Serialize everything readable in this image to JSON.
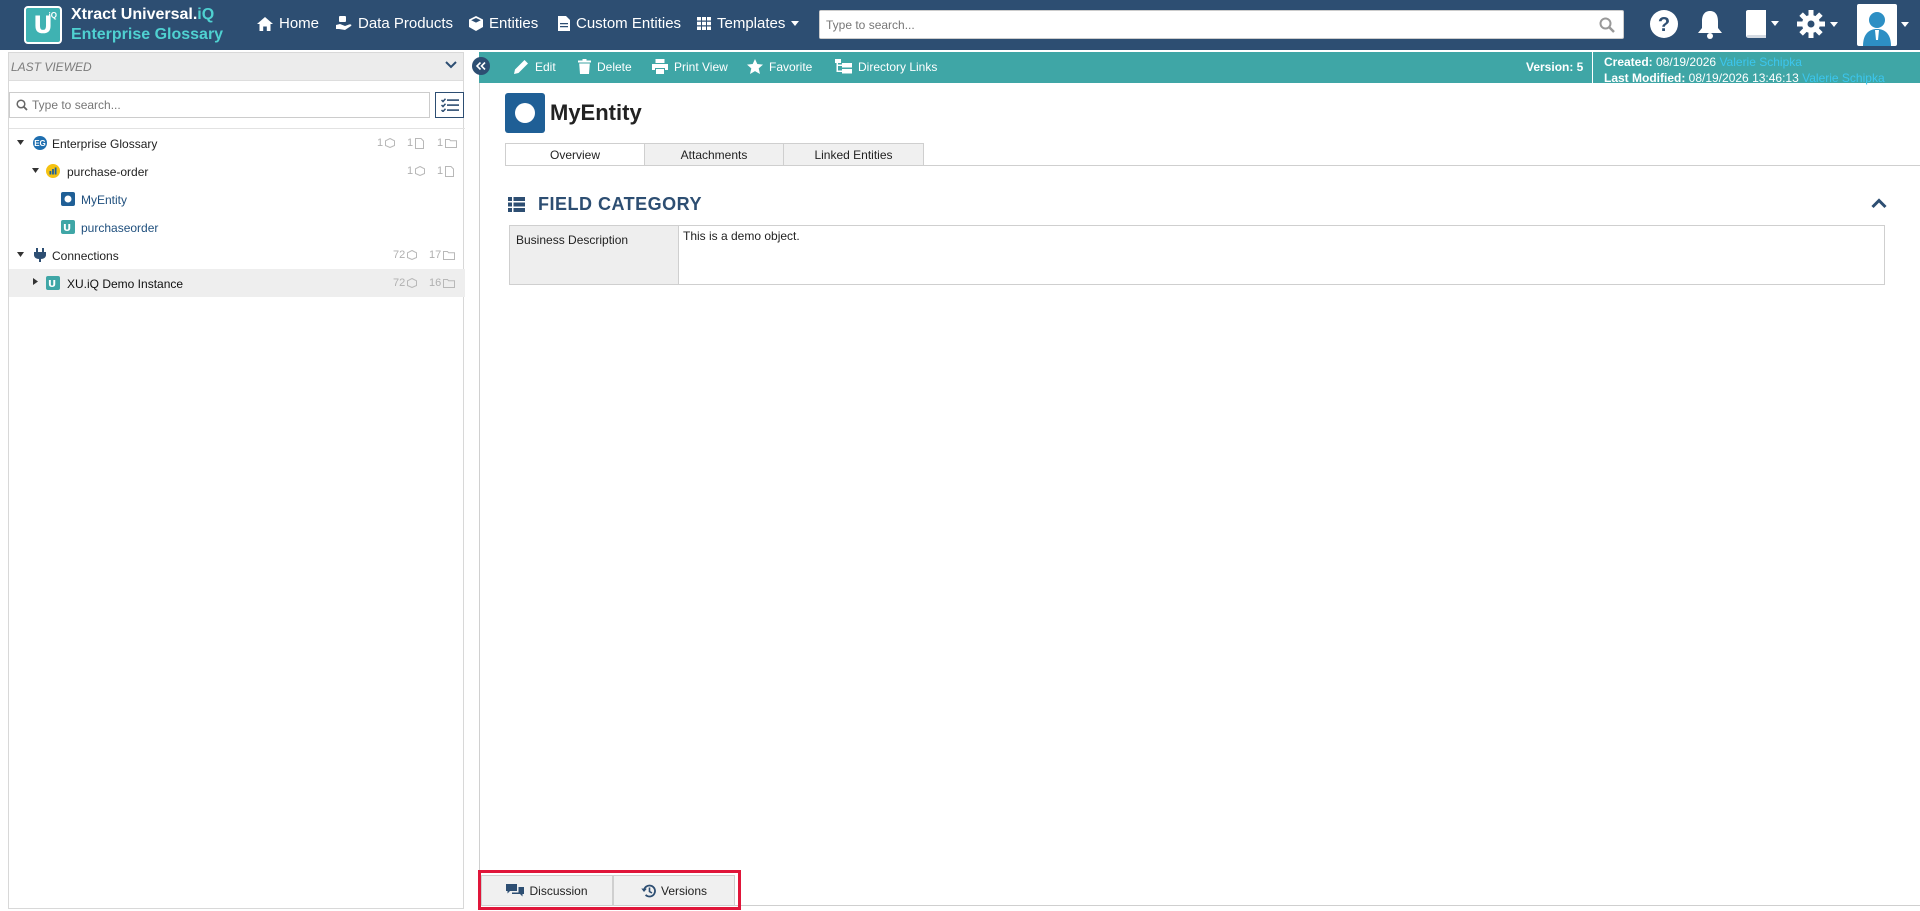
{
  "app": {
    "brand_line1": "Xtract Universal.",
    "brand_iq": "iQ",
    "brand_line2": "Enterprise Glossary",
    "logo_letter": "U",
    "logo_sup": "iQ"
  },
  "nav": {
    "home": "Home",
    "data_products": "Data Products",
    "entities": "Entities",
    "custom_entities": "Custom Entities",
    "templates": "Templates",
    "search_placeholder": "Type to search..."
  },
  "left": {
    "last_viewed": "LAST VIEWED",
    "search_placeholder": "Type to search...",
    "tree": [
      {
        "label": "Enterprise Glossary",
        "c1": "1",
        "c2": "1",
        "c3": "1"
      },
      {
        "label": "purchase-order",
        "c1": "1",
        "c2": "1"
      },
      {
        "label": "MyEntity"
      },
      {
        "label": "purchaseorder"
      },
      {
        "label": "Connections",
        "c1": "72",
        "c3": "17"
      },
      {
        "label": "XU.iQ Demo Instance",
        "c1": "72",
        "c3": "16"
      }
    ]
  },
  "toolbar": {
    "edit": "Edit",
    "delete": "Delete",
    "print_view": "Print View",
    "favorite": "Favorite",
    "directory_links": "Directory Links",
    "version": "Version: 5",
    "created_label": "Created:",
    "created_date": "08/19/2026",
    "created_user": "Valerie Schipka",
    "modified_label": "Last Modified:",
    "modified_date": "08/19/2026 13:46:13",
    "modified_user": "Valerie Schipka"
  },
  "entity": {
    "title": "MyEntity",
    "tabs": [
      "Overview",
      "Attachments",
      "Linked Entities"
    ]
  },
  "field_category": {
    "title": "FIELD CATEGORY",
    "rows": [
      {
        "label": "Business Description",
        "value": "This is a demo object."
      }
    ]
  },
  "bottom": {
    "discussion": "Discussion",
    "versions": "Versions"
  },
  "colors": {
    "nav_bg": "#2d4e72",
    "toolbar_bg": "#3fa6a6",
    "accent_teal": "#4fd1d1",
    "entity_icon": "#1f5f96",
    "highlight": "#e0163a",
    "user_link": "#3cc6ee"
  }
}
